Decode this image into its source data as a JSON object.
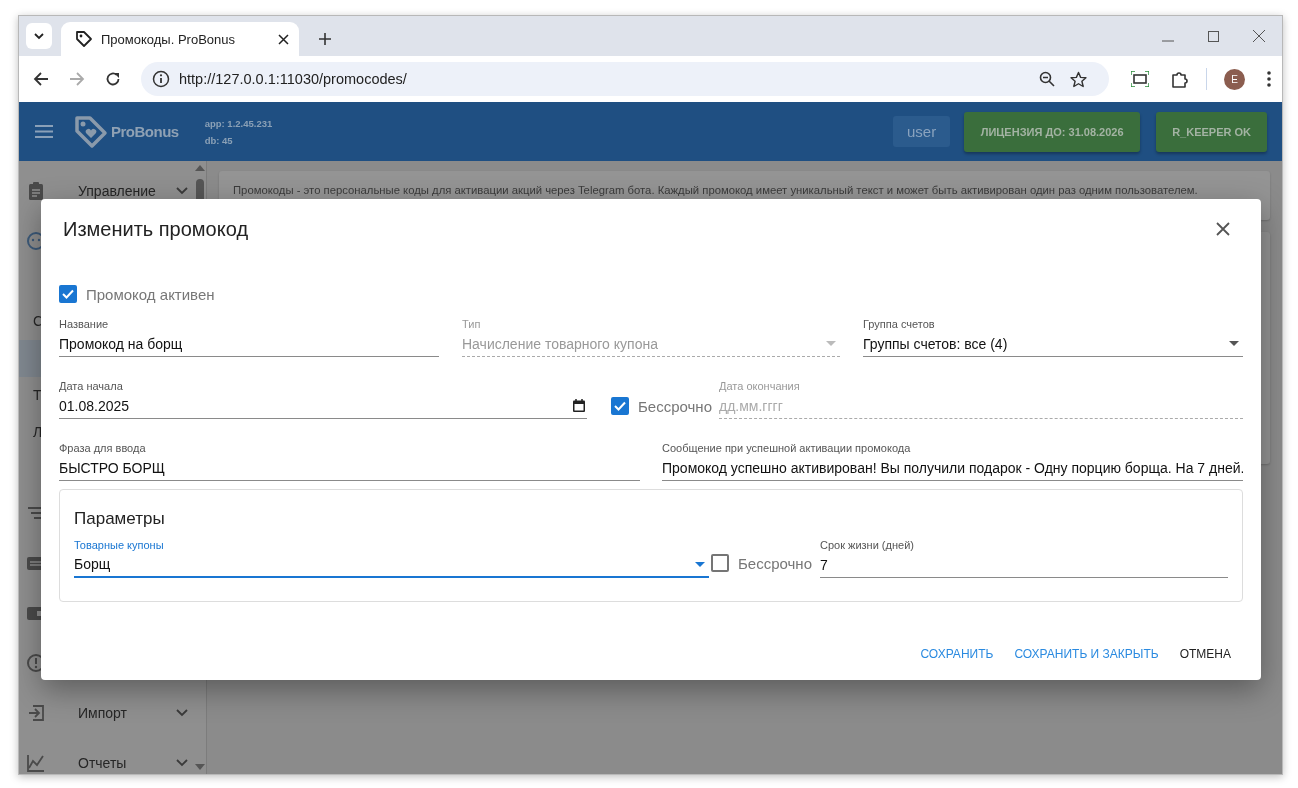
{
  "browser": {
    "tab_title": "Промокоды. ProBonus",
    "url": "http://127.0.0.1:11030/promocodes/",
    "profile_initial": "E"
  },
  "header": {
    "logo": "ProBonus",
    "app_version": "app: 1.2.45.231",
    "db_version": "db: 45",
    "user": "user",
    "buttons": [
      "ЛИЦЕНЗИЯ ДО: 31.08.2026",
      "R_KEEPER OK"
    ]
  },
  "sidebar": {
    "items": [
      {
        "kind": "group",
        "label": "Управление"
      },
      {
        "kind": "icon"
      },
      {
        "kind": "sub",
        "selected": false
      },
      {
        "kind": "sub",
        "label": "С",
        "selected": false
      },
      {
        "kind": "sub",
        "selected": true
      },
      {
        "kind": "sub",
        "label": "Т",
        "selected": false
      },
      {
        "kind": "sub",
        "label": "Л",
        "selected": false
      },
      {
        "kind": "sub",
        "selected": false
      },
      {
        "kind": "icon"
      },
      {
        "kind": "icon"
      },
      {
        "kind": "icon"
      },
      {
        "kind": "icon"
      },
      {
        "kind": "group",
        "label": "Импорт"
      },
      {
        "kind": "group",
        "label": "Отчеты"
      }
    ]
  },
  "info": "Промокоды - это персональные коды для активации акций через Telegram бота. Каждый промокод имеет уникальный текст и может быть активирован один раз одним пользователем.",
  "dialog": {
    "title": "Изменить промокод",
    "active": {
      "label": "Промокод активен",
      "checked": true
    },
    "name": {
      "label": "Название",
      "value": "Промокод на борщ"
    },
    "type": {
      "label": "Тип",
      "value": "Начисление товарного купона",
      "disabled": true
    },
    "account_group": {
      "label": "Группа счетов",
      "value": "Группы счетов: все (4)"
    },
    "start_date": {
      "label": "Дата начала",
      "value": "01.08.2025"
    },
    "unlimited": {
      "label": "Бессрочно",
      "checked": true
    },
    "end_date": {
      "label": "Дата окончания",
      "placeholder": "дд.мм.гггг",
      "disabled": true
    },
    "phrase": {
      "label": "Фраза для ввода",
      "value": "БЫСТРО БОРЩ"
    },
    "message": {
      "label": "Сообщение при успешной активации промокода",
      "value": "Промокод успешно активирован! Вы получили подарок - Одну порцию борща. На 7 дней."
    },
    "parameters": {
      "title": "Параметры",
      "coupons": {
        "label": "Товарные купоны",
        "value": "Борщ",
        "focused": true
      },
      "unlimited": {
        "label": "Бессрочно",
        "checked": false
      },
      "lifetime": {
        "label": "Срок жизни (дней)",
        "value": "7"
      }
    },
    "buttons": [
      {
        "label": "СОХРАНИТЬ",
        "kind": "primary"
      },
      {
        "label": "СОХРАНИТЬ И ЗАКРЫТЬ",
        "kind": "primary"
      },
      {
        "label": "ОТМЕНА",
        "kind": "plain"
      }
    ]
  }
}
